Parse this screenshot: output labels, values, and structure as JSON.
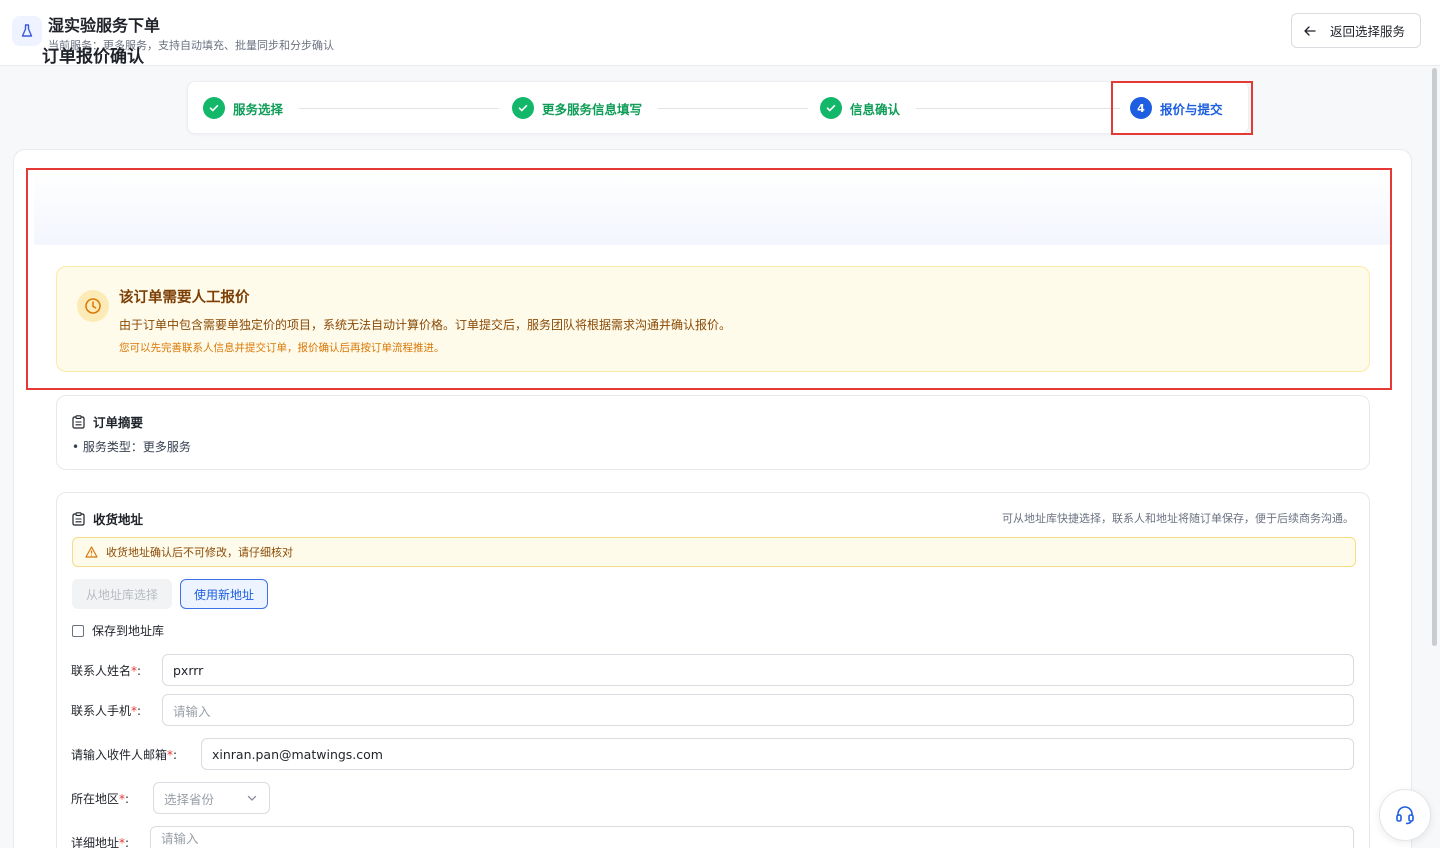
{
  "header": {
    "title": "湿实验服务下单",
    "subtitle": "当前服务：更多服务，支持自动填充、批量同步和分步确认",
    "back_label": "返回选择服务",
    "icon": "flask-icon"
  },
  "steps": [
    {
      "label": "服务选择",
      "status": "done"
    },
    {
      "label": "更多服务信息填写",
      "status": "done"
    },
    {
      "label": "信息确认",
      "status": "done"
    },
    {
      "label": "报价与提交",
      "status": "active",
      "number": "4"
    }
  ],
  "quote": {
    "title": "订单报价确认",
    "alert_title": "该订单需要人工报价",
    "alert_desc": "由于订单中包含需要单独定价的项目，系统无法自动计算价格。订单提交后，服务团队将根据需求沟通并确认报价。",
    "alert_note": "您可以先完善联系人信息并提交订单，报价确认后再按订单流程推进。"
  },
  "summary": {
    "title": "订单摘要",
    "service_line": "• 服务类型：更多服务"
  },
  "address": {
    "title": "收货地址",
    "hint": "可从地址库快捷选择，联系人和地址将随订单保存，便于后续商务沟通。",
    "warning": "收货地址确认后不可修改，请仔细核对",
    "from_library": "从地址库选择",
    "use_new": "使用新地址",
    "save_to_library": "保存到地址库",
    "fields": {
      "name_label": "联系人姓名",
      "name_value": "pxrrr",
      "phone_label": "联系人手机",
      "phone_placeholder": "请输入",
      "email_label": "请输入收件人邮箱",
      "email_value": "xinran.pan@matwings.com",
      "region_label": "所在地区",
      "region_placeholder": "选择省份",
      "detail_label": "详细地址",
      "detail_placeholder": "请输入",
      "required_mark": "*",
      "colon": ":"
    }
  },
  "colors": {
    "primary": "#1d5fe0",
    "success": "#12b76a",
    "warning_bg": "#fffbeb",
    "highlight": "#e53935"
  }
}
